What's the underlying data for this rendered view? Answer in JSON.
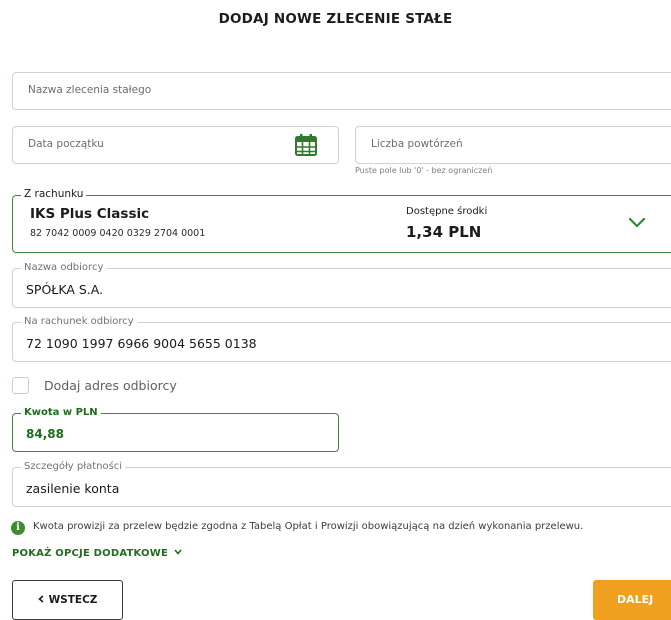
{
  "page": {
    "title": "DODAJ NOWE ZLECENIE STAŁE"
  },
  "form": {
    "order_name": {
      "placeholder": "Nazwa zlecenia stałego"
    },
    "start_date": {
      "placeholder": "Data początku",
      "icon": "calendar-icon"
    },
    "repetitions": {
      "placeholder": "Liczba powtórzeń",
      "hint": "Puste pole lub '0' - bez ograniczeń"
    },
    "from_account": {
      "legend": "Z rachunku",
      "name": "IKS Plus Classic",
      "number": "82 7042 0009 0420 0329 2704 0001",
      "available_label": "Dostępne środki",
      "available_value": "1,34 PLN",
      "icon": "chevron-down-icon"
    },
    "recipient_name": {
      "legend": "Nazwa odbiorcy",
      "value": "SPÓŁKA S.A."
    },
    "recipient_account": {
      "legend": "Na rachunek odbiorcy",
      "value": "72 1090 1997 6966 9004 5655 0138"
    },
    "add_address": {
      "label": "Dodaj adres odbiorcy",
      "checked": false
    },
    "amount": {
      "legend": "Kwota w PLN",
      "value": "84,88"
    },
    "details": {
      "legend": "Szczegóły płatności",
      "value": "zasilenie konta"
    }
  },
  "info": {
    "icon": "info-icon",
    "text": "Kwota prowizji za przelew będzie zgodna z Tabelą Opłat i Prowizji obowiązującą na dzień wykonania przelewu."
  },
  "more_options": {
    "label": "POKAŻ OPCJE DODATKOWE",
    "icon": "chevron-down-icon"
  },
  "buttons": {
    "back": "WSTECZ",
    "back_icon": "chevron-left-icon",
    "next": "DALEJ"
  },
  "colors": {
    "accent_green": "#3d8a3d",
    "dark_green": "#246b24",
    "orange": "#f0a01e"
  }
}
